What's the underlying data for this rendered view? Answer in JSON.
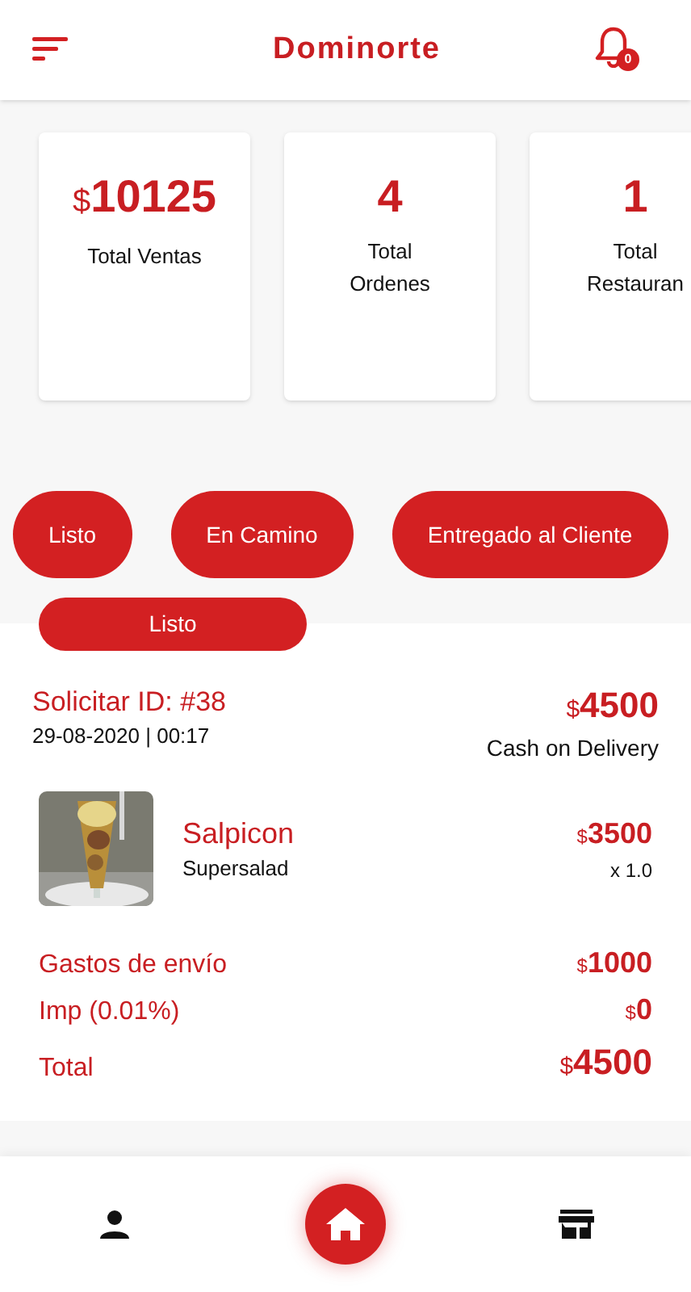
{
  "header": {
    "title": "Dominorte",
    "notification_count": "0"
  },
  "stats": [
    {
      "currency": "$",
      "value": "10125",
      "label": "Total Ventas"
    },
    {
      "value": "4",
      "label": "Total Ordenes"
    },
    {
      "value": "1",
      "label": "Total Restauran"
    }
  ],
  "filters": [
    "Listo",
    "En Camino",
    "Entregado al Cliente"
  ],
  "order": {
    "status": "Listo",
    "title": "Solicitar ID: #38",
    "datetime": "29-08-2020 | 00:17",
    "total_currency": "$",
    "total": "4500",
    "payment": "Cash on Delivery",
    "items": [
      {
        "name": "Salpicon",
        "restaurant": "Supersalad",
        "currency": "$",
        "price": "3500",
        "quantity": "x 1.0"
      }
    ],
    "summary": [
      {
        "label": "Gastos de envío",
        "currency": "$",
        "value": "1000",
        "kind": "fee"
      },
      {
        "label": "Imp (0.01%)",
        "currency": "$",
        "value": "0",
        "kind": "fee"
      },
      {
        "label": "Total",
        "currency": "$",
        "value": "4500",
        "kind": "total"
      }
    ]
  },
  "nav": [
    {
      "kind": "profile"
    },
    {
      "kind": "home"
    },
    {
      "kind": "store"
    }
  ]
}
